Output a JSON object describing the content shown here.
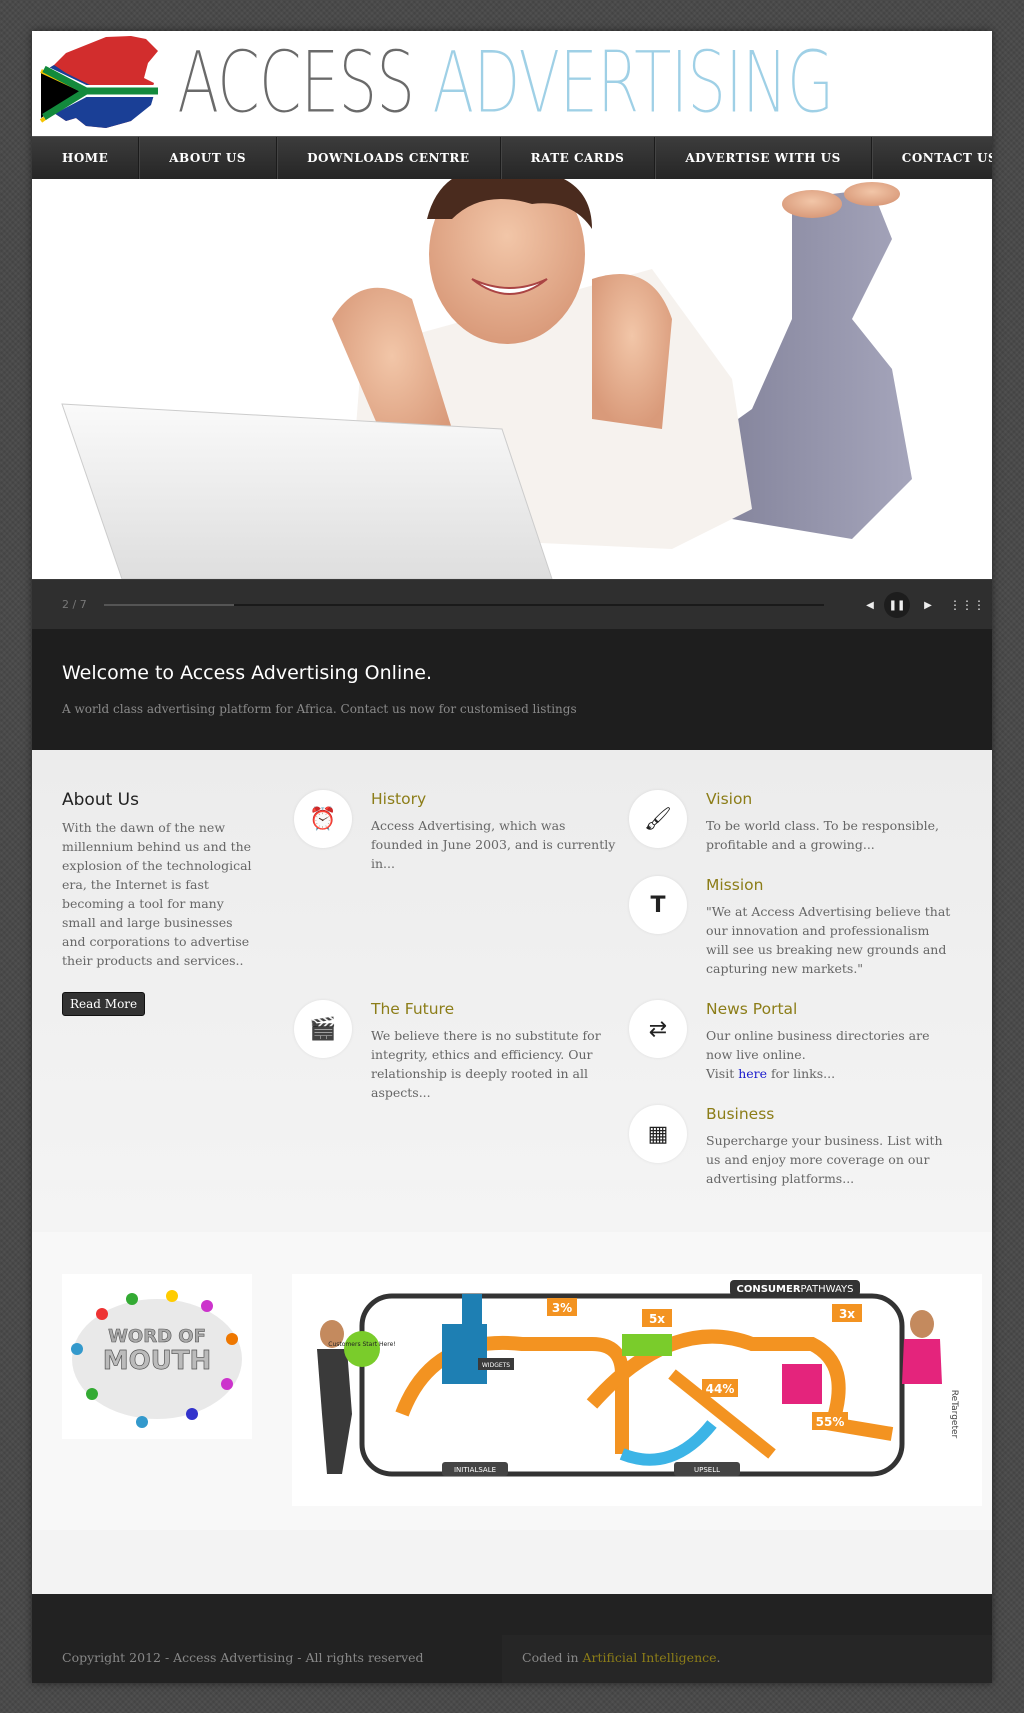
{
  "header": {
    "logo_word1": "ACCESS",
    "logo_word2": "ADVERTISING"
  },
  "nav": {
    "items": [
      {
        "label": "HOME"
      },
      {
        "label": "ABOUT US"
      },
      {
        "label": "DOWNLOADS CENTRE"
      },
      {
        "label": "RATE CARDS"
      },
      {
        "label": "ADVERTISE WITH US"
      },
      {
        "label": "CONTACT US"
      }
    ]
  },
  "slider": {
    "counter": "2 / 7",
    "progress_fraction": 0.18,
    "prev_icon": "prev-arrow-icon",
    "pause_icon": "pause-icon",
    "next_icon": "next-arrow-icon",
    "grid_icon": "grid-icon"
  },
  "welcome": {
    "title": "Welcome to Access Advertising Online.",
    "subtitle": "A world class advertising platform for Africa. Contact us now for customised listings"
  },
  "about": {
    "title": "About Us",
    "text": "With the dawn of the new millennium behind us and the explosion of the technological era, the Internet is fast becoming a tool for many small and large businesses and corporations to advertise their products and services..",
    "button": "Read More"
  },
  "features": {
    "history": {
      "title": "History",
      "text": "Access Advertising, which was founded in June 2003, and is currently in...",
      "icon": "alarm-clock-icon"
    },
    "future": {
      "title": "The Future",
      "text": "We believe there is no substitute for integrity, ethics and efficiency. Our relationship is deeply rooted in all aspects...",
      "icon": "clapperboard-icon"
    },
    "vision": {
      "title": "Vision",
      "text": "To be world class. To be responsible, profitable and a growing...",
      "icon": "brush-icon"
    },
    "mission": {
      "title": "Mission",
      "text": "\"We at Access Advertising believe that our innovation and professionalism will see us breaking new grounds and capturing new markets.\"",
      "icon": "text-t-icon"
    },
    "news": {
      "title": "News Portal",
      "text1": "Our online business directories are now live online.",
      "text2_pre": "Visit ",
      "link": "here",
      "text2_post": " for links...",
      "icon": "shuffle-icon"
    },
    "business": {
      "title": "Business",
      "text": "Supercharge your business. List with us and enjoy more coverage on our advertising platforms...",
      "icon": "layout-icon"
    }
  },
  "images": {
    "wom_text1": "WORD OF",
    "wom_text2": "MOUTH",
    "info_title_bold": "CONSUMER",
    "info_title_rest": "PATHWAYS",
    "info_start": "Customers Start Here!",
    "info_pct1": "3%",
    "info_pct2": "5x",
    "info_pct3": "3x",
    "info_pct4": "44%",
    "info_pct5": "55%",
    "info_initialsale": "INITIALSALE",
    "info_upsell": "UPSELL",
    "info_brand": "ReTargeter",
    "info_widgets": "WIDGETS"
  },
  "footer": {
    "copyright": "Copyright 2012 - Access Advertising - All rights reserved",
    "coded_pre": "Coded in ",
    "coded_link": "Artificial Intelligence",
    "coded_post": "."
  }
}
